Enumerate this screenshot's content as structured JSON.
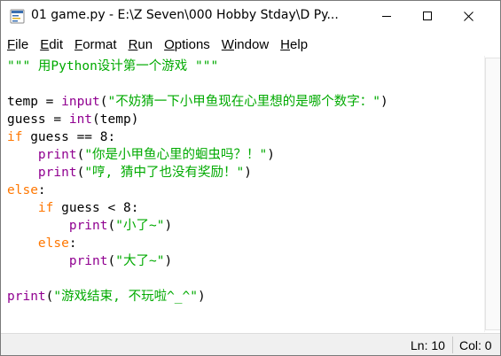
{
  "window": {
    "title": "01 game.py - E:\\Z Seven\\000 Hobby Stday\\D Py..."
  },
  "menubar": {
    "items": [
      {
        "label": "File",
        "accel": "F",
        "rest": "ile"
      },
      {
        "label": "Edit",
        "accel": "E",
        "rest": "dit"
      },
      {
        "label": "Format",
        "accel": "F",
        "rest": "ormat"
      },
      {
        "label": "Run",
        "accel": "R",
        "rest": "un"
      },
      {
        "label": "Options",
        "accel": "O",
        "rest": "ptions"
      },
      {
        "label": "Window",
        "accel": "W",
        "rest": "indow"
      },
      {
        "label": "Help",
        "accel": "H",
        "rest": "elp"
      }
    ]
  },
  "editor": {
    "lines": [
      [
        {
          "t": "\"\"\" 用Python设计第一个游戏 \"\"\"",
          "c": "st"
        }
      ],
      [],
      [
        {
          "t": "temp = ",
          "c": ""
        },
        {
          "t": "input",
          "c": "bi"
        },
        {
          "t": "(",
          "c": ""
        },
        {
          "t": "\"不妨猜一下小甲鱼现在心里想的是哪个数字：\"",
          "c": "st"
        },
        {
          "t": ")",
          "c": ""
        }
      ],
      [
        {
          "t": "guess = ",
          "c": ""
        },
        {
          "t": "int",
          "c": "bi"
        },
        {
          "t": "(temp)",
          "c": ""
        }
      ],
      [
        {
          "t": "if",
          "c": "kw"
        },
        {
          "t": " guess == 8:",
          "c": ""
        }
      ],
      [
        {
          "t": "    ",
          "c": ""
        },
        {
          "t": "print",
          "c": "bi"
        },
        {
          "t": "(",
          "c": ""
        },
        {
          "t": "\"你是小甲鱼心里的蛔虫吗？！\"",
          "c": "st"
        },
        {
          "t": ")",
          "c": ""
        }
      ],
      [
        {
          "t": "    ",
          "c": ""
        },
        {
          "t": "print",
          "c": "bi"
        },
        {
          "t": "(",
          "c": ""
        },
        {
          "t": "\"哼, 猜中了也没有奖励！\"",
          "c": "st"
        },
        {
          "t": ")",
          "c": ""
        }
      ],
      [
        {
          "t": "else",
          "c": "kw"
        },
        {
          "t": ":",
          "c": ""
        }
      ],
      [
        {
          "t": "    ",
          "c": ""
        },
        {
          "t": "if",
          "c": "kw"
        },
        {
          "t": " guess < 8:",
          "c": ""
        }
      ],
      [
        {
          "t": "        ",
          "c": ""
        },
        {
          "t": "print",
          "c": "bi"
        },
        {
          "t": "(",
          "c": ""
        },
        {
          "t": "\"小了~\"",
          "c": "st"
        },
        {
          "t": ")",
          "c": ""
        }
      ],
      [
        {
          "t": "    ",
          "c": ""
        },
        {
          "t": "else",
          "c": "kw"
        },
        {
          "t": ":",
          "c": ""
        }
      ],
      [
        {
          "t": "        ",
          "c": ""
        },
        {
          "t": "print",
          "c": "bi"
        },
        {
          "t": "(",
          "c": ""
        },
        {
          "t": "\"大了~\"",
          "c": "st"
        },
        {
          "t": ")",
          "c": ""
        }
      ],
      [],
      [
        {
          "t": "print",
          "c": "bi"
        },
        {
          "t": "(",
          "c": ""
        },
        {
          "t": "\"游戏结束, 不玩啦^_^\"",
          "c": "st"
        },
        {
          "t": ")",
          "c": ""
        }
      ]
    ]
  },
  "statusbar": {
    "line": "Ln: 10",
    "col": "Col: 0"
  },
  "colors": {
    "keyword": "#ff7700",
    "builtin": "#900090",
    "string": "#00aa00"
  },
  "icons": {
    "app": "python-idle-icon",
    "minimize": "minimize-icon",
    "maximize": "maximize-icon",
    "close": "close-icon"
  }
}
